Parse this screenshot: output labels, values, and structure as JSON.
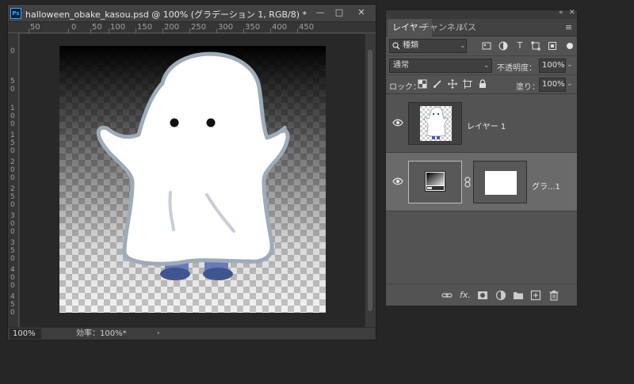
{
  "document": {
    "title": "halloween_obake_kasou.psd @ 100% (グラデーション 1, RGB/8) *",
    "app_icon": "Ps",
    "window_buttons": {
      "minimize": "—",
      "maximize": "□",
      "close": "✕"
    },
    "ruler_h_labels": [
      "50",
      "0",
      "50",
      "100",
      "150",
      "200",
      "250",
      "300",
      "350",
      "400",
      "450"
    ],
    "ruler_v_labels": [
      "0",
      "5\n0",
      "1\n0\n0",
      "1\n5\n0",
      "2\n0\n0",
      "2\n5\n0",
      "3\n0\n0",
      "3\n5\n0",
      "4\n0\n0",
      "4\n5\n0"
    ],
    "status": {
      "zoom": "100%",
      "efficiency": "効率：100%*",
      "arrow": "›"
    }
  },
  "layers_panel": {
    "header_icons": {
      "collapse": "«",
      "close": "✕"
    },
    "tabs": [
      {
        "label": "レイヤー",
        "active": true
      },
      {
        "label": "チャンネル",
        "active": false
      },
      {
        "label": "パス",
        "active": false
      }
    ],
    "menu_icon": "≡",
    "filter": {
      "search_icon": "🔍",
      "value": "種類"
    },
    "filter_icons": [
      "image-filter-icon",
      "adjustment-filter-icon",
      "type-filter-icon",
      "shape-filter-icon",
      "smart-object-filter-icon"
    ],
    "blend_mode": "通常",
    "opacity_label": "不透明度：",
    "opacity_value": "100%",
    "lock_label": "ロック：",
    "fill_label": "塗り：",
    "fill_value": "100%",
    "layers": [
      {
        "name": "レイヤー 1",
        "visible": true,
        "selected": false
      },
      {
        "name": "グラ...1",
        "visible": true,
        "selected": true
      }
    ],
    "footer_icons": [
      "link-icon",
      "fx-icon",
      "mask-icon",
      "adjustment-icon",
      "folder-icon",
      "new-layer-icon",
      "trash-icon"
    ],
    "fx_label": "fx."
  }
}
